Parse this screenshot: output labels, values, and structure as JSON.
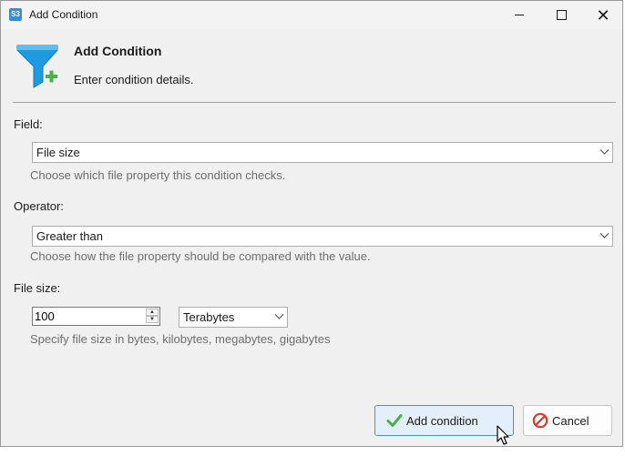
{
  "window": {
    "title": "Add Condition",
    "app_icon_text": "S3",
    "controls": [
      "minimize",
      "maximize",
      "close"
    ]
  },
  "header": {
    "title": "Add Condition",
    "subtitle": "Enter condition details.",
    "icon": "funnel-add-icon"
  },
  "form": {
    "field": {
      "label": "Field:",
      "value": "File size",
      "hint": "Choose which file property this condition checks."
    },
    "operator": {
      "label": "Operator:",
      "value": "Greater than",
      "hint": "Choose how the file property should be compared with the value."
    },
    "file_size": {
      "label": "File size:",
      "value": "100",
      "unit": "Terabytes",
      "hint": "Specify file size in bytes, kilobytes, megabytes, gigabytes"
    }
  },
  "buttons": {
    "add_label": "Add condition",
    "cancel_label": "Cancel"
  },
  "colors": {
    "funnel": "#1e9be0",
    "plus": "#4caf50",
    "primary_border": "#4b8ed6",
    "cancel_red": "#e0392b"
  }
}
